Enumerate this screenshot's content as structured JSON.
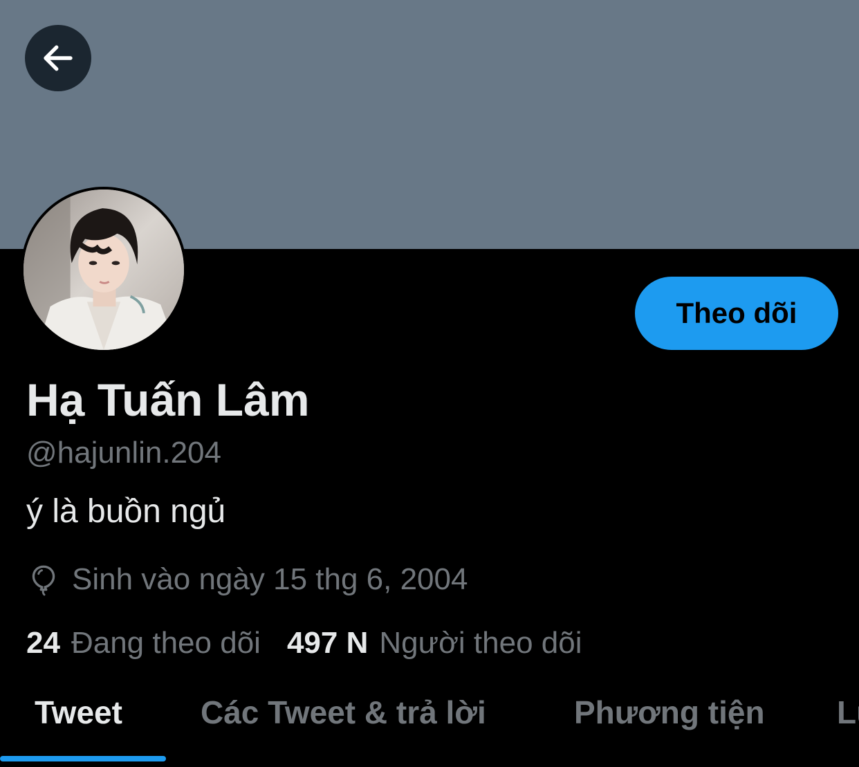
{
  "header": {
    "back_icon": "arrow-left-icon",
    "banner_color": "#687887"
  },
  "profile": {
    "avatar_icon": "profile-photo",
    "follow_label": "Theo dõi",
    "display_name": "Hạ Tuấn Lâm",
    "handle": "@hajunlin.204",
    "bio": "ý là buồn ngủ",
    "birthday_icon": "balloon-icon",
    "birthday": "Sinh vào ngày 15 thg 6, 2004",
    "following_count": "24",
    "following_label": "Đang theo dõi",
    "followers_count": "497 N",
    "followers_label": "Người theo dõi"
  },
  "tabs": [
    {
      "label": "Tweet",
      "active": true
    },
    {
      "label": "Các Tweet & trả lời",
      "active": false
    },
    {
      "label": "Phương tiện",
      "active": false
    },
    {
      "label": "Lư",
      "active": false
    }
  ],
  "colors": {
    "accent": "#1d9bf0",
    "background": "#000000",
    "text_primary": "#e7e9ea",
    "text_secondary": "#71767b"
  }
}
